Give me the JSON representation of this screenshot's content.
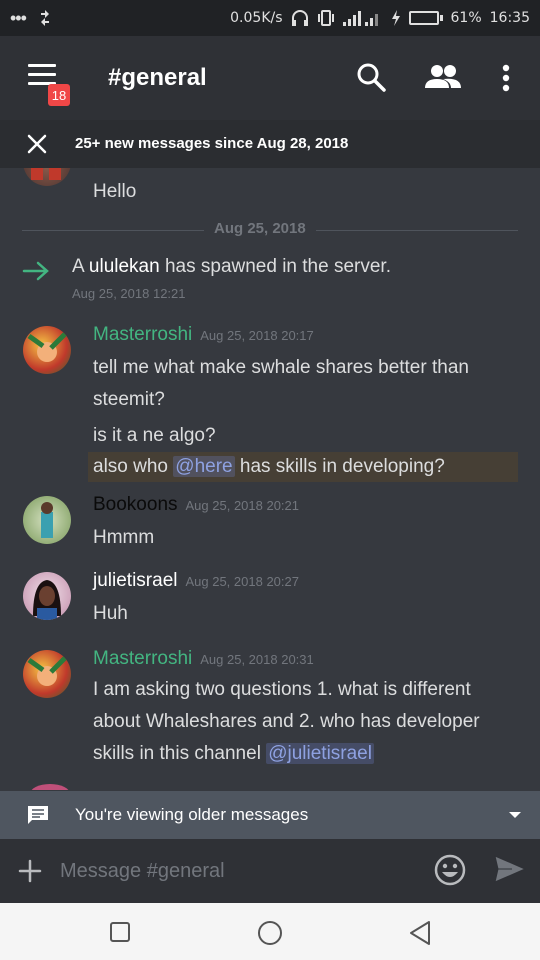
{
  "status_bar": {
    "left_icons": [
      "more-dots-icon",
      "sync-icon"
    ],
    "net_speed": "0.05K/s",
    "battery_pct": "61%",
    "battery_level": 0.61,
    "time": "16:35"
  },
  "app_bar": {
    "channel": "#general",
    "unread_badge": "18"
  },
  "new_messages_bar": {
    "text": "25+ new messages since Aug 28, 2018"
  },
  "messages": [
    {
      "author": "",
      "timestamp": "",
      "lines": [
        "Hello"
      ]
    },
    {
      "divider": "Aug 25, 2018"
    },
    {
      "system": true,
      "prefix": "A ",
      "user": "ululekan",
      "suffix": " has spawned in the server.",
      "timestamp": "Aug 25, 2018 12:21"
    },
    {
      "author": "Masterroshi",
      "author_color": "#43b581",
      "timestamp": "Aug 25, 2018 20:17",
      "lines": [
        "tell me what make swhale shares better than",
        "steemit?",
        "is it a ne algo?"
      ],
      "highlight_line": {
        "before": "also who ",
        "mention": "@here",
        "after": " has skills in developing?"
      }
    },
    {
      "author": "Bookoons",
      "author_color": "#0a0a0a",
      "timestamp": "Aug 25, 2018 20:21",
      "lines": [
        "Hmmm"
      ]
    },
    {
      "author": "julietisrael",
      "author_color": "#ffffff",
      "timestamp": "Aug 25, 2018 20:27",
      "lines": [
        "Huh"
      ]
    },
    {
      "author": "Masterroshi",
      "author_color": "#43b581",
      "timestamp": "Aug 25, 2018 20:31",
      "lines": [
        "I am asking two questions 1. what is different",
        "about Whaleshares and 2. who has developer",
        "skills in this channel "
      ],
      "mention": "@julietisrael"
    }
  ],
  "older_bar": {
    "text": "You're viewing older messages"
  },
  "composer": {
    "placeholder": "Message #general"
  },
  "colors": {
    "accent_green": "#43b581",
    "mention_blue": "#8ea1e1",
    "badge_red": "#f04747"
  }
}
